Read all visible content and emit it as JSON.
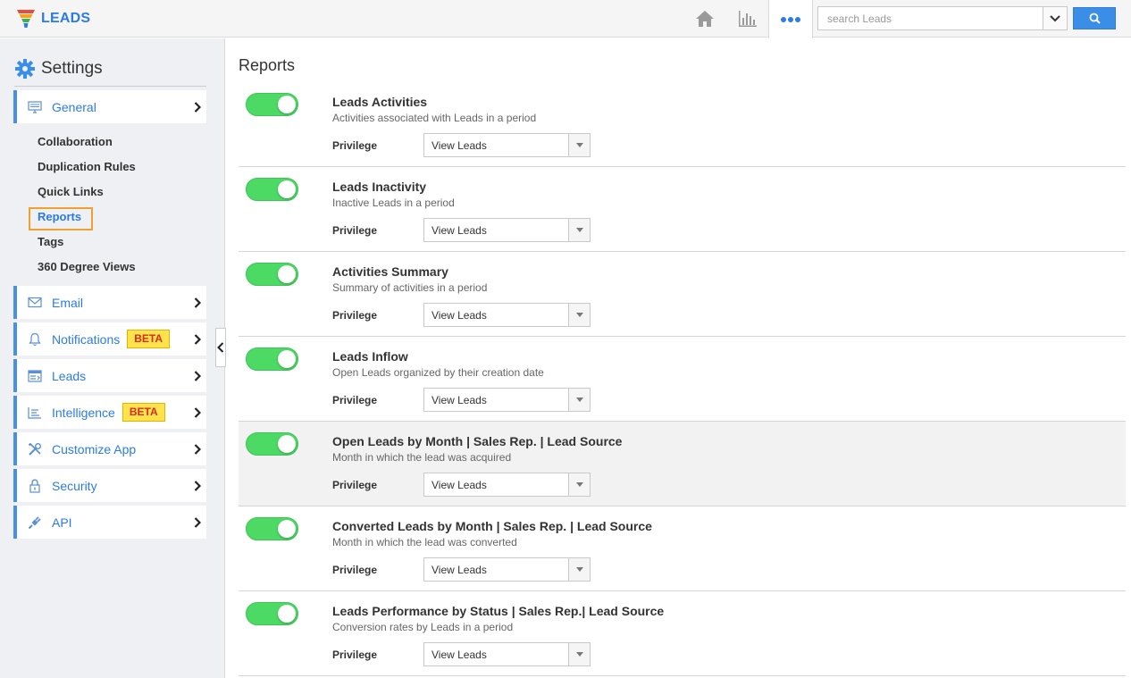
{
  "app": {
    "title": "LEADS"
  },
  "search": {
    "placeholder": "search Leads"
  },
  "sidebar": {
    "title": "Settings",
    "general": {
      "label": "General"
    },
    "sub_items": [
      "Collaboration",
      "Duplication Rules",
      "Quick Links",
      "Reports",
      "Tags",
      "360 Degree Views"
    ],
    "active_sub_item": "Reports",
    "items": [
      {
        "label": "Email",
        "icon": "envelope-icon"
      },
      {
        "label": "Notifications",
        "icon": "bell-icon",
        "badge": "BETA"
      },
      {
        "label": "Leads",
        "icon": "leads-form-icon"
      },
      {
        "label": "Intelligence",
        "icon": "intelligence-icon",
        "badge": "BETA"
      },
      {
        "label": "Customize App",
        "icon": "tools-icon"
      },
      {
        "label": "Security",
        "icon": "lock-icon"
      },
      {
        "label": "API",
        "icon": "plug-icon"
      }
    ]
  },
  "main": {
    "title": "Reports",
    "privilege_label": "Privilege",
    "reports": [
      {
        "title": "Leads Activities",
        "desc": "Activities associated with Leads in a period",
        "privilege": "View Leads",
        "enabled": true
      },
      {
        "title": "Leads Inactivity",
        "desc": "Inactive Leads in a period",
        "privilege": "View Leads",
        "enabled": true
      },
      {
        "title": "Activities Summary",
        "desc": "Summary of activities in a period",
        "privilege": "View Leads",
        "enabled": true
      },
      {
        "title": "Leads Inflow",
        "desc": "Open Leads organized by their creation date",
        "privilege": "View Leads",
        "enabled": true
      },
      {
        "title": "Open Leads by Month | Sales Rep. | Lead Source",
        "desc": "Month in which the lead was acquired",
        "privilege": "View Leads",
        "enabled": true
      },
      {
        "title": "Converted Leads by Month | Sales Rep. | Lead Source",
        "desc": "Month in which the lead was converted",
        "privilege": "View Leads",
        "enabled": true
      },
      {
        "title": "Leads Performance by Status | Sales Rep.| Lead Source",
        "desc": "Conversion rates by Leads in a period",
        "privilege": "View Leads",
        "enabled": true
      }
    ]
  },
  "colors": {
    "accent": "#2c7be5",
    "toggle_on": "#4cd964",
    "beta_bg": "#ffe34d",
    "beta_text": "#d62d20",
    "active_outline": "#f0a030"
  }
}
